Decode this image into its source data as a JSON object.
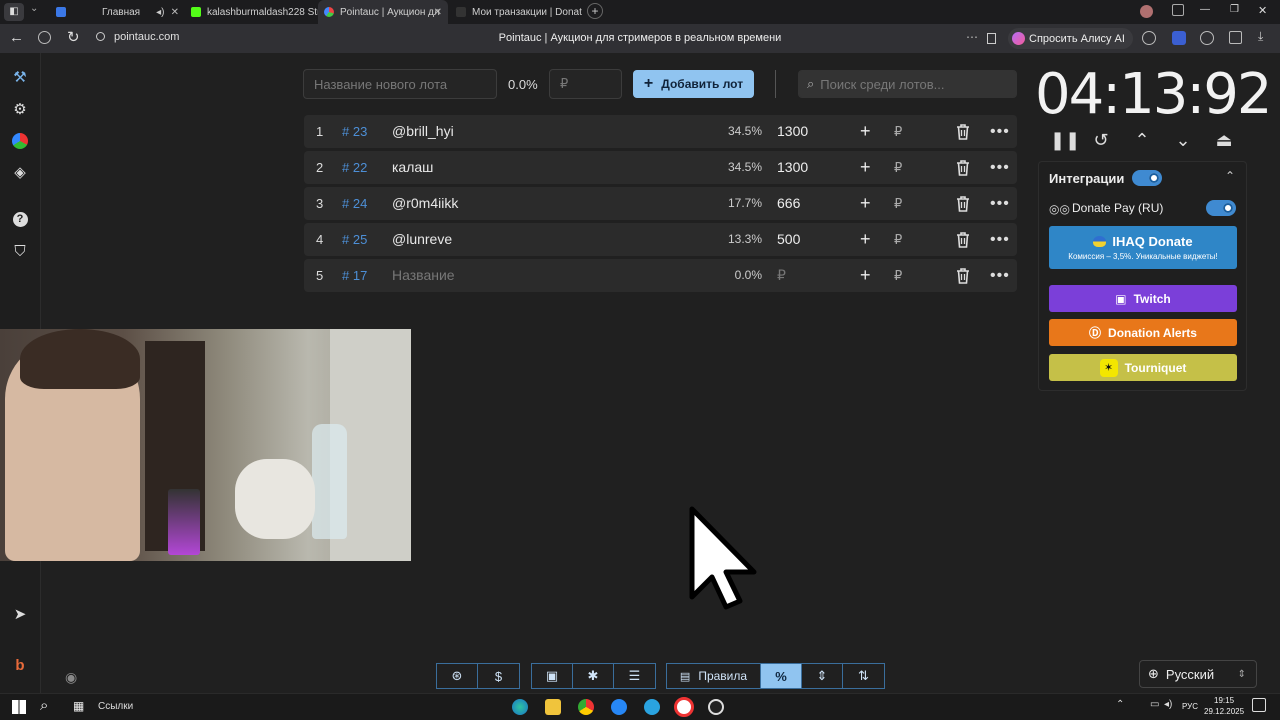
{
  "browser": {
    "tabs": [
      {
        "label": "Главная",
        "active": false
      },
      {
        "label": "kalashburmaldash228 Str",
        "active": false
      },
      {
        "label": "Pointauc | Аукцион дл",
        "active": true
      },
      {
        "label": "Мои транзакции | Donat",
        "active": false
      }
    ],
    "url": "pointauc.com",
    "page_title": "Pointauc | Аукцион для стримеров в реальном времени",
    "ask_alice": "Спросить Алису AI"
  },
  "controls": {
    "new_lot_placeholder": "Название нового лота",
    "new_lot_percent": "0.0%",
    "currency_placeholder": "₽",
    "add_lot_label": "Добавить лот",
    "search_placeholder": "Поиск среди лотов..."
  },
  "lots": [
    {
      "rank": "1",
      "id": "# 23",
      "name": "@brill_hyi",
      "percent": "34.5%",
      "amount": "1300",
      "placeholder": false
    },
    {
      "rank": "2",
      "id": "# 22",
      "name": "калаш",
      "percent": "34.5%",
      "amount": "1300",
      "placeholder": false
    },
    {
      "rank": "3",
      "id": "# 24",
      "name": "@r0m4iikk",
      "percent": "17.7%",
      "amount": "666",
      "placeholder": false
    },
    {
      "rank": "4",
      "id": "# 25",
      "name": "@lunreve",
      "percent": "13.3%",
      "amount": "500",
      "placeholder": false
    },
    {
      "rank": "5",
      "id": "# 17",
      "name": "Название",
      "percent": "0.0%",
      "amount": "₽",
      "placeholder": true
    }
  ],
  "lot_currency_symbol": "₽",
  "timer": {
    "display": "04:13:92"
  },
  "integrations": {
    "title": "Интеграции",
    "donatepay_label": "Donate Pay (RU)",
    "ihaq_title": "IHAQ Donate",
    "ihaq_subtitle": "Комиссия – 3,5%. Уникальные виджеты!",
    "services": [
      {
        "label": "Twitch",
        "color": "#7b3fd9"
      },
      {
        "label": "Donation Alerts",
        "color": "#e8771a"
      },
      {
        "label": "Tourniquet",
        "color": "#c5c048"
      }
    ]
  },
  "toolbar": {
    "rules_label": "Правила"
  },
  "language": {
    "selected": "Русский"
  },
  "taskbar": {
    "links_label": "Ссылки",
    "lang": "РУС",
    "time": "19:15",
    "date": "29.12.2025"
  },
  "colors": {
    "accent": "#90c4f0",
    "id_blue": "#4d8fd6",
    "toggle_on": "#3f8ad1",
    "ihaq": "#2f86c7"
  }
}
